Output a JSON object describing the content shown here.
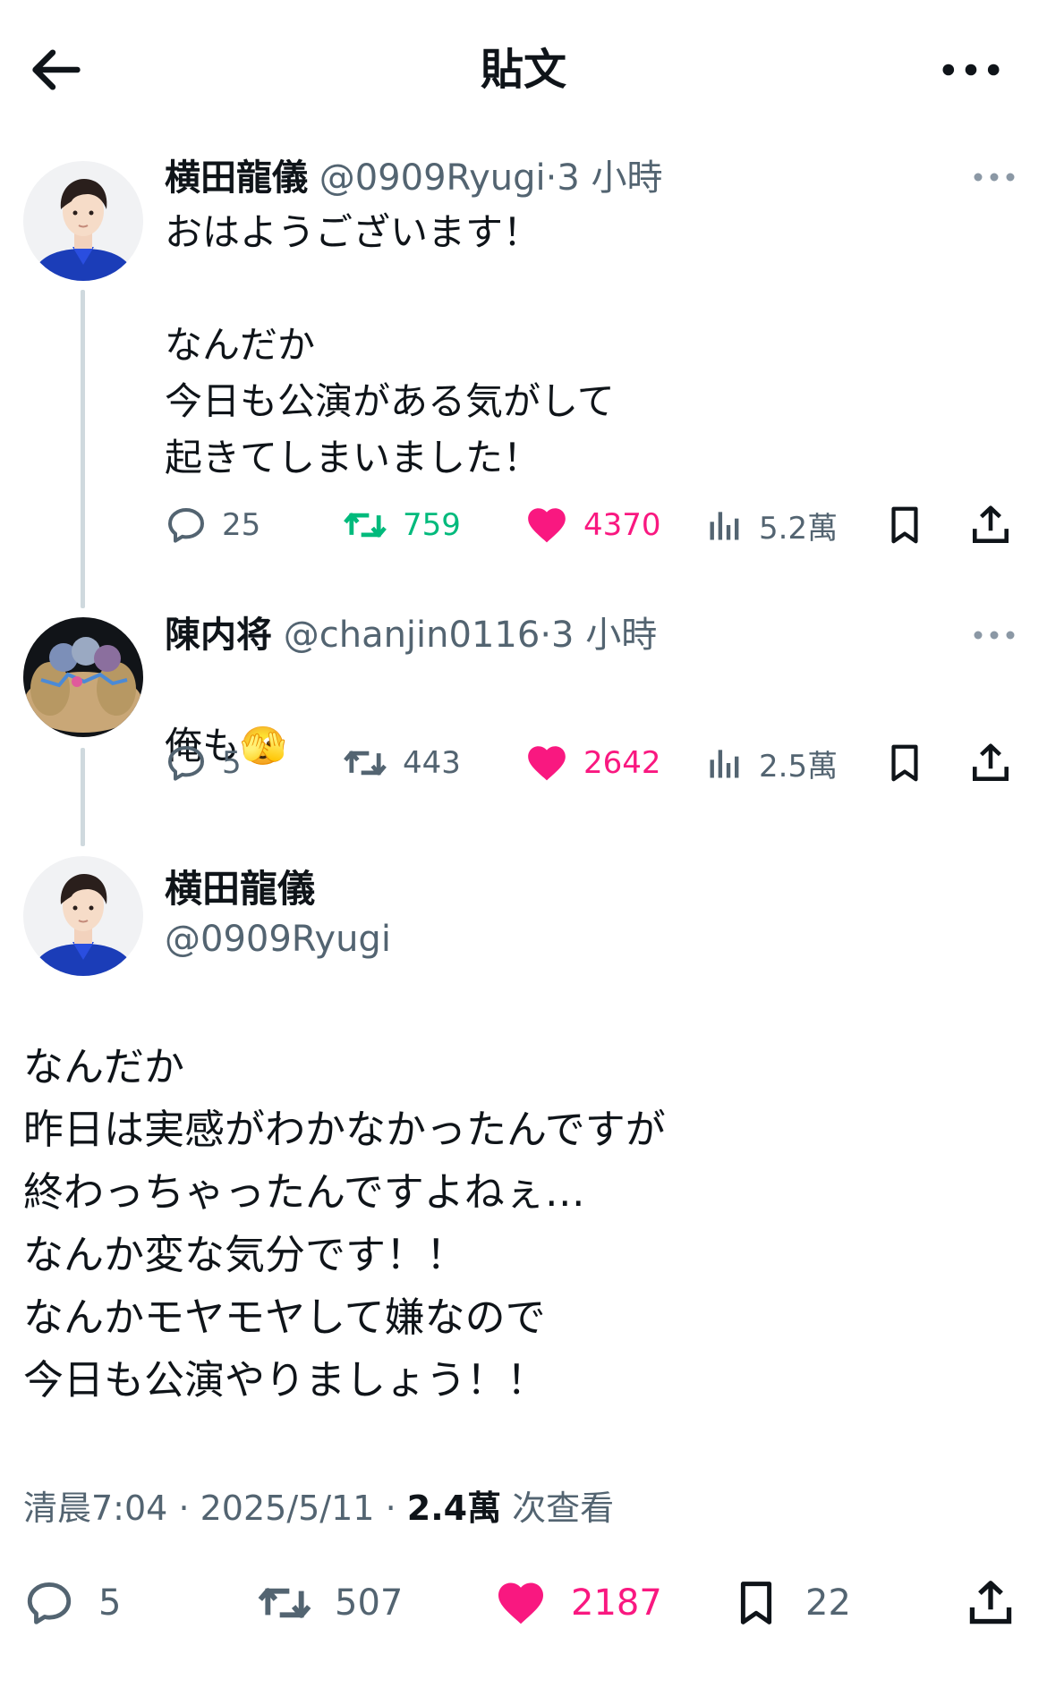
{
  "header": {
    "title": "貼文"
  },
  "thread": [
    {
      "name": "横田龍儀",
      "handle": "@0909Ryugi",
      "sep": "·",
      "time": "3 小時",
      "text": "おはようございます！\n\nなんだか\n今日も公演がある気がして\n起きてしまいました！",
      "replies": "25",
      "retweets": "759",
      "likes": "4370",
      "views": "5.2萬"
    },
    {
      "name": "陳内将",
      "handle": "@chanjin0116",
      "sep": "·",
      "time": "3 小時",
      "text": "俺も",
      "emoji": "🫣",
      "replies": "5",
      "retweets": "443",
      "likes": "2642",
      "views": "2.5萬"
    }
  ],
  "main": {
    "name": "横田龍儀",
    "handle": "@0909Ryugi",
    "text": "なんだか\n昨日は実感がわかなかったんですが\n終わっちゃったんですよねぇ…\nなんか変な気分です！！\nなんかモヤモヤして嫌なので\n今日も公演やりましょう！！",
    "time": "清晨7:04",
    "sep1": "·",
    "date": "2025/5/11",
    "sep2": "·",
    "views_count": "2.4萬",
    "views_label": "次查看",
    "replies": "5",
    "retweets": "507",
    "likes": "2187",
    "bookmarks": "22"
  },
  "colors": {
    "like": "#f91880",
    "retweet_active": "#00ba7c",
    "muted": "#536471",
    "text": "#0f1419",
    "line": "#cfd9de"
  },
  "icons": [
    "back-arrow-icon",
    "more-icon",
    "reply-icon",
    "retweet-icon",
    "like-icon",
    "views-icon",
    "bookmark-icon",
    "share-icon"
  ]
}
